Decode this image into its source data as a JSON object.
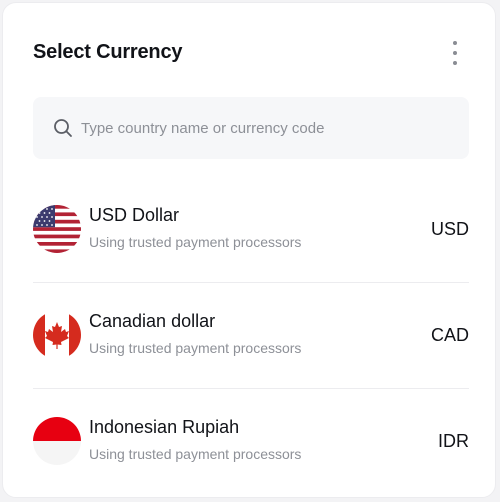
{
  "header": {
    "title": "Select Currency"
  },
  "search": {
    "placeholder": "Type country name or currency code",
    "value": ""
  },
  "currencies": [
    {
      "name": "USD Dollar",
      "subtitle": "Using trusted payment processors",
      "code": "USD",
      "flag_icon": "us-flag-icon"
    },
    {
      "name": "Canadian dollar",
      "subtitle": "Using trusted payment processors",
      "code": "CAD",
      "flag_icon": "canada-flag-icon"
    },
    {
      "name": "Indonesian Rupiah",
      "subtitle": "Using trusted payment processors",
      "code": "IDR",
      "flag_icon": "indonesia-flag-icon"
    }
  ],
  "colors": {
    "text_primary": "#111318",
    "text_secondary": "#8d9097",
    "search_bg": "#f6f7f9",
    "divider": "#ececef",
    "us_red": "#b22234",
    "us_blue": "#3c3b6e",
    "canada_red": "#d52b1e",
    "indonesia_red": "#e70011"
  }
}
